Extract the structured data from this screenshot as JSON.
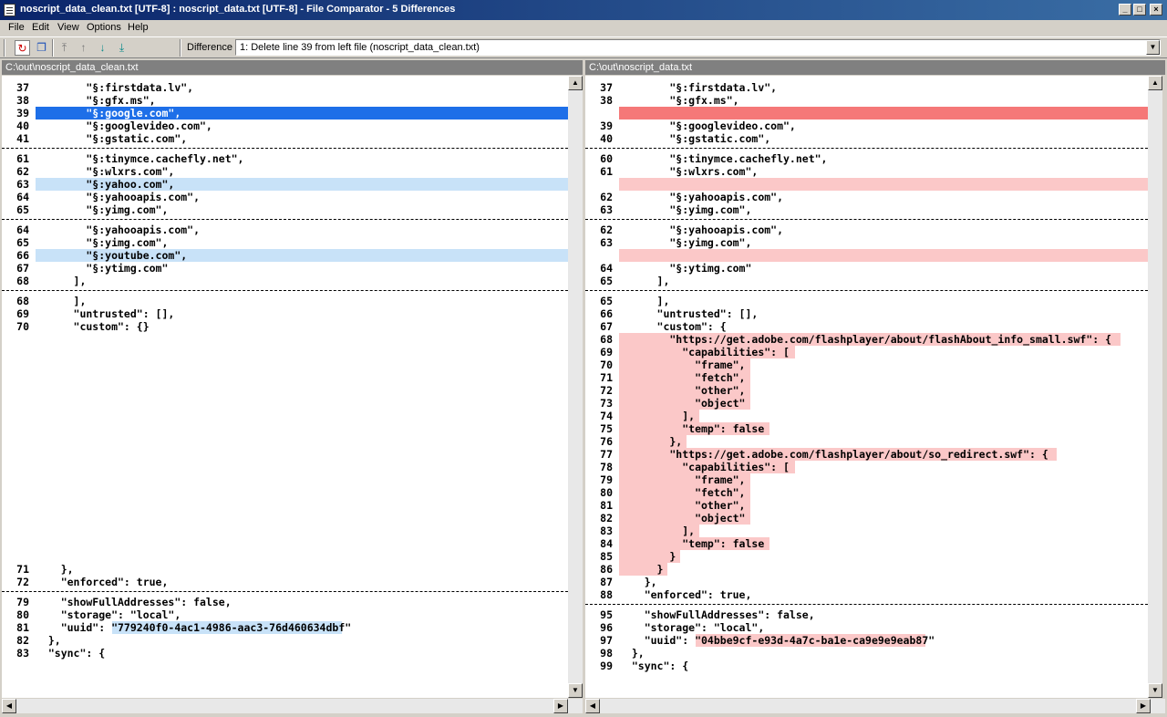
{
  "window": {
    "title": "noscript_data_clean.txt [UTF-8] : noscript_data.txt [UTF-8] - File Comparator - 5 Differences",
    "minimize": "_",
    "maximize": "□",
    "close": "×"
  },
  "menu": [
    "File",
    "Edit",
    "View",
    "Options",
    "Help"
  ],
  "toolbar": {
    "icons": [
      "refresh-icon",
      "copy-icon",
      "first-diff-icon",
      "prev-diff-icon",
      "next-diff-icon",
      "last-diff-icon"
    ],
    "difference_label": "Difference",
    "difference_value": "1: Delete line 39 from left file (noscript_data_clean.txt)"
  },
  "colors": {
    "selected": "#1e6fe8",
    "left_change": "#c8e2f8",
    "right_selected": "#f57878",
    "right_change": "#fbc8c8"
  },
  "left": {
    "path": "C:\\out\\noscript_data_clean.txt",
    "lines": [
      {
        "n": "37",
        "t": "        \"§:firstdata.lv\","
      },
      {
        "n": "38",
        "t": "        \"§:gfx.ms\","
      },
      {
        "n": "39",
        "t": "        \"§:google.com\",",
        "hl": "selected"
      },
      {
        "n": "40",
        "t": "        \"§:googlevideo.com\","
      },
      {
        "n": "41",
        "t": "        \"§:gstatic.com\","
      },
      {
        "sep": true
      },
      {
        "n": "61",
        "t": "        \"§:tinymce.cachefly.net\","
      },
      {
        "n": "62",
        "t": "        \"§:wlxrs.com\","
      },
      {
        "n": "63",
        "t": "        \"§:yahoo.com\",",
        "hl": "change"
      },
      {
        "n": "64",
        "t": "        \"§:yahooapis.com\","
      },
      {
        "n": "65",
        "t": "        \"§:yimg.com\","
      },
      {
        "sep": true
      },
      {
        "n": "64",
        "t": "        \"§:yahooapis.com\","
      },
      {
        "n": "65",
        "t": "        \"§:yimg.com\","
      },
      {
        "n": "66",
        "t": "        \"§:youtube.com\",",
        "hl": "change"
      },
      {
        "n": "67",
        "t": "        \"§:ytimg.com\""
      },
      {
        "n": "68",
        "t": "      ],"
      },
      {
        "sep": true
      },
      {
        "n": "68",
        "t": "      ],"
      },
      {
        "n": "69",
        "t": "      \"untrusted\": [],"
      },
      {
        "n": "70",
        "t": "      \"custom\": {}"
      },
      {
        "blank": true
      },
      {
        "blank": true
      },
      {
        "blank": true
      },
      {
        "blank": true
      },
      {
        "blank": true
      },
      {
        "blank": true
      },
      {
        "blank": true
      },
      {
        "blank": true
      },
      {
        "blank": true
      },
      {
        "blank": true
      },
      {
        "blank": true
      },
      {
        "blank": true
      },
      {
        "blank": true
      },
      {
        "blank": true
      },
      {
        "blank": true
      },
      {
        "blank": true
      },
      {
        "blank": true
      },
      {
        "blank": true
      },
      {
        "n": "71",
        "t": "    },"
      },
      {
        "n": "72",
        "t": "    \"enforced\": true,"
      },
      {
        "sep": true
      },
      {
        "n": "79",
        "t": "    \"showFullAddresses\": false,"
      },
      {
        "n": "80",
        "t": "    \"storage\": \"local\","
      },
      {
        "n": "81",
        "t": "    \"uuid\": \"779240f0-4ac1-4986-aac3-76d460634dbf\"",
        "inline": {
          "start": 12,
          "len": 36
        }
      },
      {
        "n": "82",
        "t": "  },"
      },
      {
        "n": "83",
        "t": "  \"sync\": {"
      }
    ]
  },
  "right": {
    "path": "C:\\out\\noscript_data.txt",
    "lines": [
      {
        "n": "37",
        "t": "        \"§:firstdata.lv\","
      },
      {
        "n": "38",
        "t": "        \"§:gfx.ms\","
      },
      {
        "n": "",
        "t": "",
        "hl": "selected"
      },
      {
        "n": "39",
        "t": "        \"§:googlevideo.com\","
      },
      {
        "n": "40",
        "t": "        \"§:gstatic.com\","
      },
      {
        "sep": true
      },
      {
        "n": "60",
        "t": "        \"§:tinymce.cachefly.net\","
      },
      {
        "n": "61",
        "t": "        \"§:wlxrs.com\","
      },
      {
        "n": "",
        "t": "",
        "hl": "change"
      },
      {
        "n": "62",
        "t": "        \"§:yahooapis.com\","
      },
      {
        "n": "63",
        "t": "        \"§:yimg.com\","
      },
      {
        "sep": true
      },
      {
        "n": "62",
        "t": "        \"§:yahooapis.com\","
      },
      {
        "n": "63",
        "t": "        \"§:yimg.com\","
      },
      {
        "n": "",
        "t": "",
        "hl": "change"
      },
      {
        "n": "64",
        "t": "        \"§:ytimg.com\""
      },
      {
        "n": "65",
        "t": "      ],"
      },
      {
        "sep": true
      },
      {
        "n": "65",
        "t": "      ],"
      },
      {
        "n": "66",
        "t": "      \"untrusted\": [],"
      },
      {
        "n": "67",
        "t": "      \"custom\": {"
      },
      {
        "n": "68",
        "t": "        \"https://get.adobe.com/flashplayer/about/flashAbout_info_small.swf\": {",
        "hl": "text"
      },
      {
        "n": "69",
        "t": "          \"capabilities\": [",
        "hl": "text"
      },
      {
        "n": "70",
        "t": "            \"frame\",",
        "hl": "text"
      },
      {
        "n": "71",
        "t": "            \"fetch\",",
        "hl": "text"
      },
      {
        "n": "72",
        "t": "            \"other\",",
        "hl": "text"
      },
      {
        "n": "73",
        "t": "            \"object\"",
        "hl": "text"
      },
      {
        "n": "74",
        "t": "          ],",
        "hl": "text"
      },
      {
        "n": "75",
        "t": "          \"temp\": false",
        "hl": "text"
      },
      {
        "n": "76",
        "t": "        },",
        "hl": "text"
      },
      {
        "n": "77",
        "t": "        \"https://get.adobe.com/flashplayer/about/so_redirect.swf\": {",
        "hl": "text"
      },
      {
        "n": "78",
        "t": "          \"capabilities\": [",
        "hl": "text"
      },
      {
        "n": "79",
        "t": "            \"frame\",",
        "hl": "text"
      },
      {
        "n": "80",
        "t": "            \"fetch\",",
        "hl": "text"
      },
      {
        "n": "81",
        "t": "            \"other\",",
        "hl": "text"
      },
      {
        "n": "82",
        "t": "            \"object\"",
        "hl": "text"
      },
      {
        "n": "83",
        "t": "          ],",
        "hl": "text"
      },
      {
        "n": "84",
        "t": "          \"temp\": false",
        "hl": "text"
      },
      {
        "n": "85",
        "t": "        }",
        "hl": "text"
      },
      {
        "n": "86",
        "t": "      }",
        "hl": "text"
      },
      {
        "n": "87",
        "t": "    },"
      },
      {
        "n": "88",
        "t": "    \"enforced\": true,"
      },
      {
        "sep": true
      },
      {
        "n": "95",
        "t": "    \"showFullAddresses\": false,"
      },
      {
        "n": "96",
        "t": "    \"storage\": \"local\","
      },
      {
        "n": "97",
        "t": "    \"uuid\": \"04bbe9cf-e93d-4a7c-ba1e-ca9e9e9eab87\"",
        "inline": {
          "start": 12,
          "len": 36
        }
      },
      {
        "n": "98",
        "t": "  },"
      },
      {
        "n": "99",
        "t": "  \"sync\": {"
      }
    ]
  }
}
